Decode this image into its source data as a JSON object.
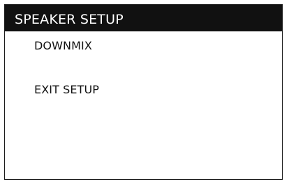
{
  "window": {
    "title": "SPEAKER SETUP"
  },
  "menu": {
    "items": [
      {
        "label": "DOWNMIX"
      },
      {
        "label": "EXIT SETUP"
      }
    ]
  },
  "colors": {
    "title_bar_bg": "#111111",
    "title_text": "#ffffff",
    "menu_text": "#111111",
    "background": "#ffffff",
    "border": "#1a1a1a"
  }
}
